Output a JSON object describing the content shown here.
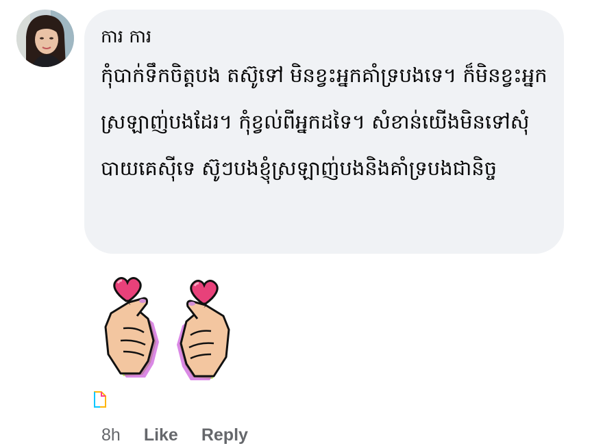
{
  "comment": {
    "author": "ការ ការ",
    "text": "កុំបាក់ទឹកចិត្តបង តស៊ូទៅ មិនខ្វះអ្នកគាំទ្របងទេ។ ក៏មិនខ្វះអ្នកស្រឡាញ់បងដែរ។ កុំខ្វល់ពីអ្នកដទៃ។ សំខាន់យើងមិនទៅសុំ បាយគេស៊ីទេ ស៊ូៗបងខ្ញុំស្រឡាញ់បងនិងគាំទ្របងជានិច្ច",
    "sticker_icon": "finger-heart-hands-sticker",
    "attachment_icon": "file-icon"
  },
  "actions": {
    "timestamp": "8h",
    "like_label": "Like",
    "reply_label": "Reply"
  },
  "colors": {
    "bubble_bg": "#f0f2f5",
    "text": "#050505",
    "secondary_text": "#65676b",
    "heart": "#e8417a"
  }
}
